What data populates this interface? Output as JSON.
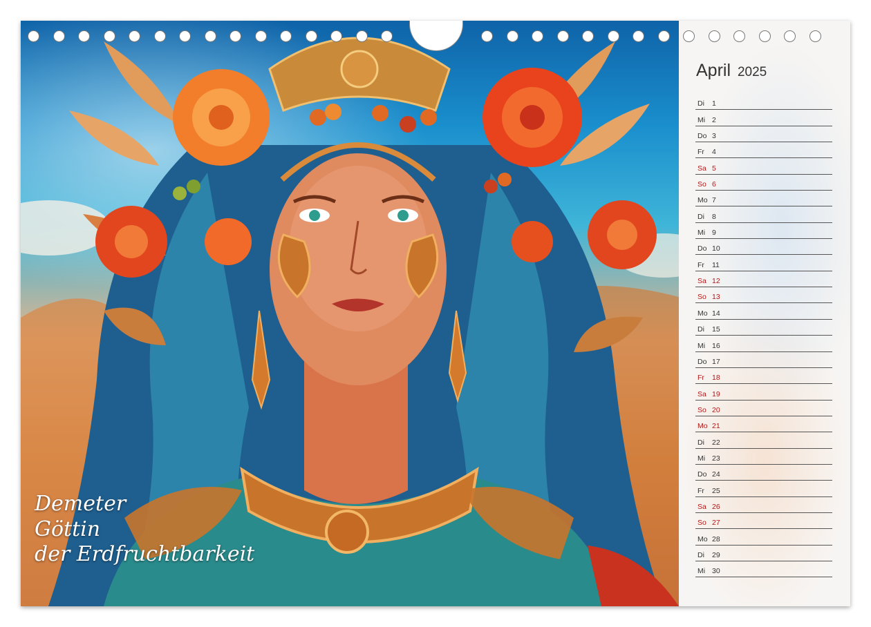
{
  "calendar": {
    "month": "April",
    "year": "2025",
    "days": [
      {
        "wd": "Di",
        "d": "1",
        "red": false
      },
      {
        "wd": "Mi",
        "d": "2",
        "red": false
      },
      {
        "wd": "Do",
        "d": "3",
        "red": false
      },
      {
        "wd": "Fr",
        "d": "4",
        "red": false
      },
      {
        "wd": "Sa",
        "d": "5",
        "red": true
      },
      {
        "wd": "So",
        "d": "6",
        "red": true
      },
      {
        "wd": "Mo",
        "d": "7",
        "red": false
      },
      {
        "wd": "Di",
        "d": "8",
        "red": false
      },
      {
        "wd": "Mi",
        "d": "9",
        "red": false
      },
      {
        "wd": "Do",
        "d": "10",
        "red": false
      },
      {
        "wd": "Fr",
        "d": "11",
        "red": false
      },
      {
        "wd": "Sa",
        "d": "12",
        "red": true
      },
      {
        "wd": "So",
        "d": "13",
        "red": true
      },
      {
        "wd": "Mo",
        "d": "14",
        "red": false
      },
      {
        "wd": "Di",
        "d": "15",
        "red": false
      },
      {
        "wd": "Mi",
        "d": "16",
        "red": false
      },
      {
        "wd": "Do",
        "d": "17",
        "red": false
      },
      {
        "wd": "Fr",
        "d": "18",
        "red": true
      },
      {
        "wd": "Sa",
        "d": "19",
        "red": true
      },
      {
        "wd": "So",
        "d": "20",
        "red": true
      },
      {
        "wd": "Mo",
        "d": "21",
        "red": true
      },
      {
        "wd": "Di",
        "d": "22",
        "red": false
      },
      {
        "wd": "Mi",
        "d": "23",
        "red": false
      },
      {
        "wd": "Do",
        "d": "24",
        "red": false
      },
      {
        "wd": "Fr",
        "d": "25",
        "red": false
      },
      {
        "wd": "Sa",
        "d": "26",
        "red": true
      },
      {
        "wd": "So",
        "d": "27",
        "red": true
      },
      {
        "wd": "Mo",
        "d": "28",
        "red": false
      },
      {
        "wd": "Di",
        "d": "29",
        "red": false
      },
      {
        "wd": "Mi",
        "d": "30",
        "red": false
      }
    ]
  },
  "caption": {
    "line1": "Demeter",
    "line2": "Göttin",
    "line3": "der Erdfruchtbarkeit"
  },
  "colors": {
    "holiday_red": "#b01818",
    "text_dark": "#333333"
  }
}
